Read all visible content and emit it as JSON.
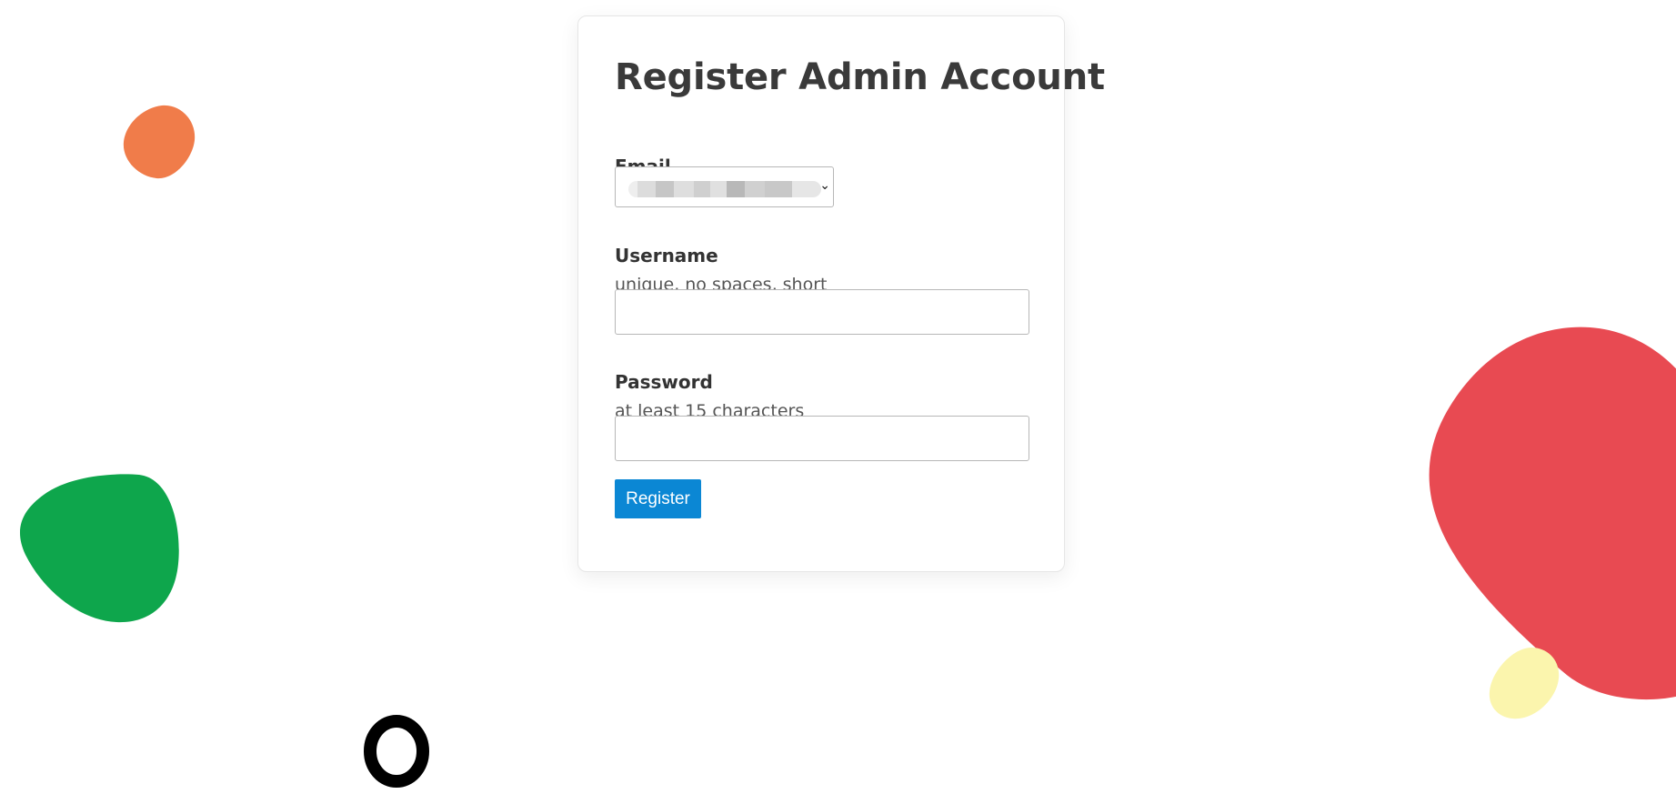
{
  "form": {
    "title": "Register Admin Account",
    "email": {
      "label": "Email",
      "selected_value": ""
    },
    "username": {
      "label": "Username",
      "hint": "unique, no spaces, short",
      "value": "",
      "placeholder": ""
    },
    "password": {
      "label": "Password",
      "hint": "at least 15 characters",
      "value": "",
      "placeholder": ""
    },
    "submit_label": "Register"
  },
  "icons": {
    "select_caret": "chevron-down-icon"
  },
  "colors": {
    "accent": "#0b87d4",
    "blob_orange": "#f07c4a",
    "blob_green": "#0ea64c",
    "blob_red": "#e84a52",
    "blob_yellow": "#fbf5ad",
    "ring_black": "#000000",
    "text": "#3a3a3a"
  }
}
